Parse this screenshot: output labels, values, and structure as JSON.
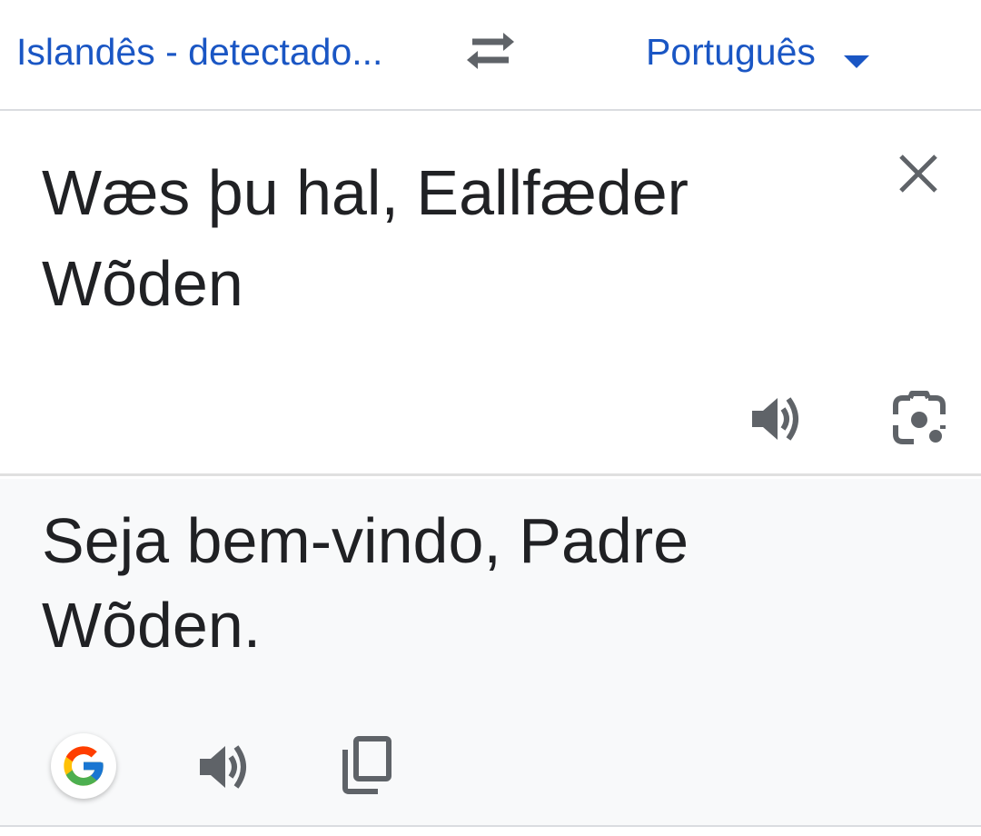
{
  "language_bar": {
    "source_language": "Islandês - detectado...",
    "target_language": "Português"
  },
  "input": {
    "source_text": "Wæs þu hal, Eallfæder Wõden"
  },
  "output": {
    "translated_text": "Seja bem-vindo, Padre Wõden."
  },
  "icons": {
    "swap": "swap-languages-icon",
    "dropdown": "chevron-down-icon",
    "clear": "close-icon",
    "speaker_source": "speaker-icon",
    "camera": "camera-lens-icon",
    "google": "google-logo",
    "speaker_output": "speaker-icon",
    "copy": "copy-icon"
  },
  "colors": {
    "accent": "#1a56c4",
    "text": "#202124",
    "icon": "#5f6368",
    "output_background": "#f8f9fa"
  }
}
